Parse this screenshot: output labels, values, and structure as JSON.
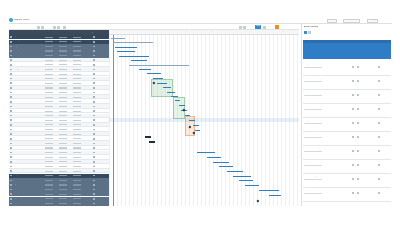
{
  "app": {
    "title": "Ganttic View ↓",
    "logo_icon": "logo-icon"
  },
  "top_links": [
    "Planner",
    "Landscape Tools",
    "Settings"
  ],
  "toolbar": {
    "view_label": "Details view ▾",
    "today_label": "Today"
  },
  "grid": {
    "columns": [
      "Name",
      "Start",
      "End",
      "Dur.",
      "Type"
    ],
    "rows": [
      {
        "label": "Project A",
        "tone": "dark"
      },
      {
        "label": "Planning",
        "tone": "dark"
      },
      {
        "label": "Design",
        "tone": "mid"
      },
      {
        "label": "Development",
        "tone": "mid"
      },
      {
        "label": "Research",
        "tone": "mid"
      },
      {
        "label": "Review",
        "tone": "light"
      },
      {
        "label": "Feature set",
        "tone": "light"
      },
      {
        "label": "Prototype",
        "tone": "light"
      },
      {
        "label": "Task 1",
        "tone": "light"
      },
      {
        "label": "Task 2",
        "tone": "light"
      },
      {
        "label": "Task 3",
        "tone": "light"
      },
      {
        "label": "Task 4",
        "tone": "light"
      },
      {
        "label": "Task 5",
        "tone": "light"
      },
      {
        "label": "Task 6",
        "tone": "light"
      },
      {
        "label": "Task 7",
        "tone": "light"
      },
      {
        "label": "Task 8",
        "tone": "light"
      },
      {
        "label": "Task 9",
        "tone": "light"
      },
      {
        "label": "Task 10",
        "tone": "light"
      },
      {
        "label": "Task 11",
        "tone": "light"
      },
      {
        "label": "Task 12",
        "tone": "light"
      },
      {
        "label": "Task 13",
        "tone": "light"
      },
      {
        "label": "Task 14",
        "tone": "light"
      },
      {
        "label": "Task 15",
        "tone": "light"
      },
      {
        "label": "Task 16",
        "tone": "light"
      },
      {
        "label": "Task 17",
        "tone": "light"
      },
      {
        "label": "Task 18",
        "tone": "light"
      },
      {
        "label": "Task 19",
        "tone": "light"
      },
      {
        "label": "Task 20",
        "tone": "light"
      },
      {
        "label": "Task 21",
        "tone": "light"
      },
      {
        "label": "Task 22",
        "tone": "light"
      },
      {
        "label": "Testing",
        "tone": "dark"
      },
      {
        "label": "QA",
        "tone": "mid"
      },
      {
        "label": "Bugs",
        "tone": "mid"
      },
      {
        "label": "Release",
        "tone": "mid"
      },
      {
        "label": "Docs",
        "tone": "mid"
      },
      {
        "label": "Support",
        "tone": "mid"
      },
      {
        "label": "Deploy",
        "tone": "mid"
      }
    ]
  },
  "gantt": {
    "months": [
      "Jan",
      "Feb",
      "Mar",
      "Apr",
      "May",
      "Jun",
      "Jul",
      "Aug"
    ]
  },
  "panel": {
    "title": "Action Planning",
    "card_title": "Summary",
    "card_value": "0%",
    "items": [
      "1 Project Setup Phase",
      "2 Requirements Gathering",
      "3 Design Phase Review",
      "4 Implementation Work",
      "5 Integration Testing",
      "6 Release Preparation",
      "7 Final Review Meeting",
      "8 Deployment Window",
      "9 Post Launch Support",
      "10 Retrospective"
    ]
  },
  "colors": {
    "accent": "#2e7fc2",
    "header": "#3a4a5a",
    "orange": "#f08a24"
  }
}
